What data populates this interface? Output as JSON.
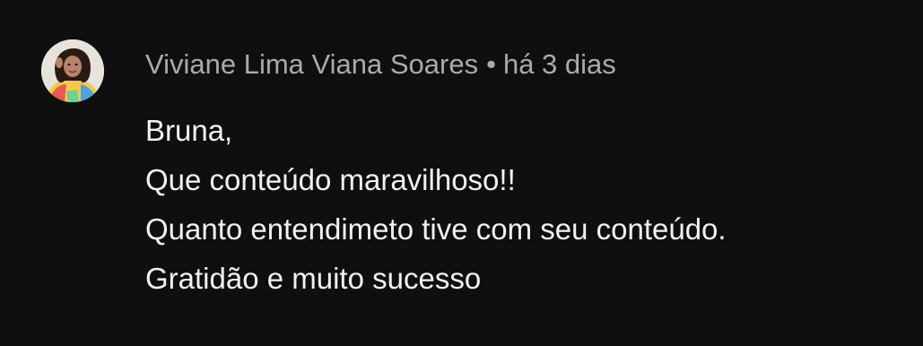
{
  "comment": {
    "author": "Viviane Lima Viana Soares",
    "separator": "•",
    "timestamp": "há 3 dias",
    "lines": [
      "Bruna,",
      "Que conteúdo maravilhoso!!",
      "Quanto entendimeto tive com seu conteúdo.",
      "Gratidão e muito sucesso"
    ]
  },
  "colors": {
    "background": "#0f0f0f",
    "meta_text": "#aaaaaa",
    "body_text": "#f1f1f1"
  }
}
